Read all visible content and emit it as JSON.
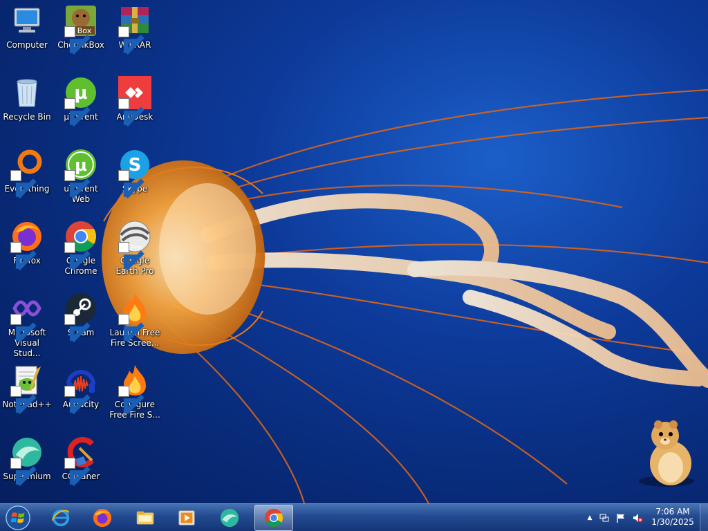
{
  "desktop": {
    "icons": [
      {
        "label": "Computer",
        "icon": "computer-icon"
      },
      {
        "label": "ChomikBox",
        "icon": "chomikbox-icon"
      },
      {
        "label": "WinRAR",
        "icon": "winrar-icon"
      },
      {
        "label": "Recycle Bin",
        "icon": "recycle-bin-icon"
      },
      {
        "label": "µTorrent",
        "icon": "utorrent-icon"
      },
      {
        "label": "AnyDesk",
        "icon": "anydesk-icon"
      },
      {
        "label": "Everything",
        "icon": "everything-icon"
      },
      {
        "label": "uTorrent Web",
        "icon": "utorrent-web-icon"
      },
      {
        "label": "Skype",
        "icon": "skype-icon"
      },
      {
        "label": "Firefox",
        "icon": "firefox-icon"
      },
      {
        "label": "Google Chrome",
        "icon": "chrome-icon"
      },
      {
        "label": "Google Earth Pro",
        "icon": "google-earth-icon"
      },
      {
        "label": "Microsoft Visual Stud...",
        "icon": "visual-studio-icon"
      },
      {
        "label": "Steam",
        "icon": "steam-icon"
      },
      {
        "label": "Launch Free Fire Scree...",
        "icon": "free-fire-icon"
      },
      {
        "label": "Notepad++",
        "icon": "notepadpp-icon"
      },
      {
        "label": "Audacity",
        "icon": "audacity-icon"
      },
      {
        "label": "Configure Free Fire S...",
        "icon": "free-fire-config-icon"
      },
      {
        "label": "Supermium",
        "icon": "supermium-icon"
      },
      {
        "label": "CCleaner",
        "icon": "ccleaner-icon"
      }
    ],
    "chomikbox_badge": "Box",
    "earth_badge": "Pro"
  },
  "taskbar": {
    "pinned": [
      {
        "name": "internet-explorer",
        "icon": "ie-icon"
      },
      {
        "name": "firefox",
        "icon": "firefox-icon"
      },
      {
        "name": "file-explorer",
        "icon": "folder-icon"
      },
      {
        "name": "media-player",
        "icon": "media-player-icon"
      },
      {
        "name": "supermium",
        "icon": "supermium-icon"
      },
      {
        "name": "chrome",
        "icon": "chrome-icon",
        "active": true
      }
    ],
    "tray": {
      "show_hidden": "▲",
      "time": "7:06 AM",
      "date": "1/30/2025"
    }
  },
  "colors": {
    "wallpaper": "#0d3a9a",
    "taskbar": "#2a5096",
    "accent_orange": "#f08a1e"
  }
}
